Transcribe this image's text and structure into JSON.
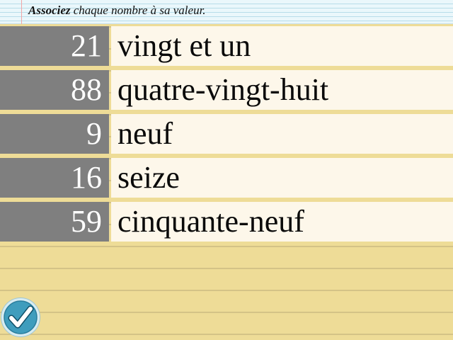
{
  "instruction": {
    "emphasis": "Associez",
    "rest": " chaque nombre à sa valeur."
  },
  "pairs": [
    {
      "number": "21",
      "word": "vingt et un"
    },
    {
      "number": "88",
      "word": "quatre-vingt-huit"
    },
    {
      "number": "9",
      "word": "neuf"
    },
    {
      "number": "16",
      "word": "seize"
    },
    {
      "number": "59",
      "word": "cinquante-neuf"
    }
  ],
  "check_button": {
    "icon": "checkmark-icon"
  },
  "colors": {
    "number_tile": "#7f7f7f",
    "word_tile": "#fdf7ea",
    "paper": "#eedc97",
    "check_circle": "#3f9dbd"
  }
}
